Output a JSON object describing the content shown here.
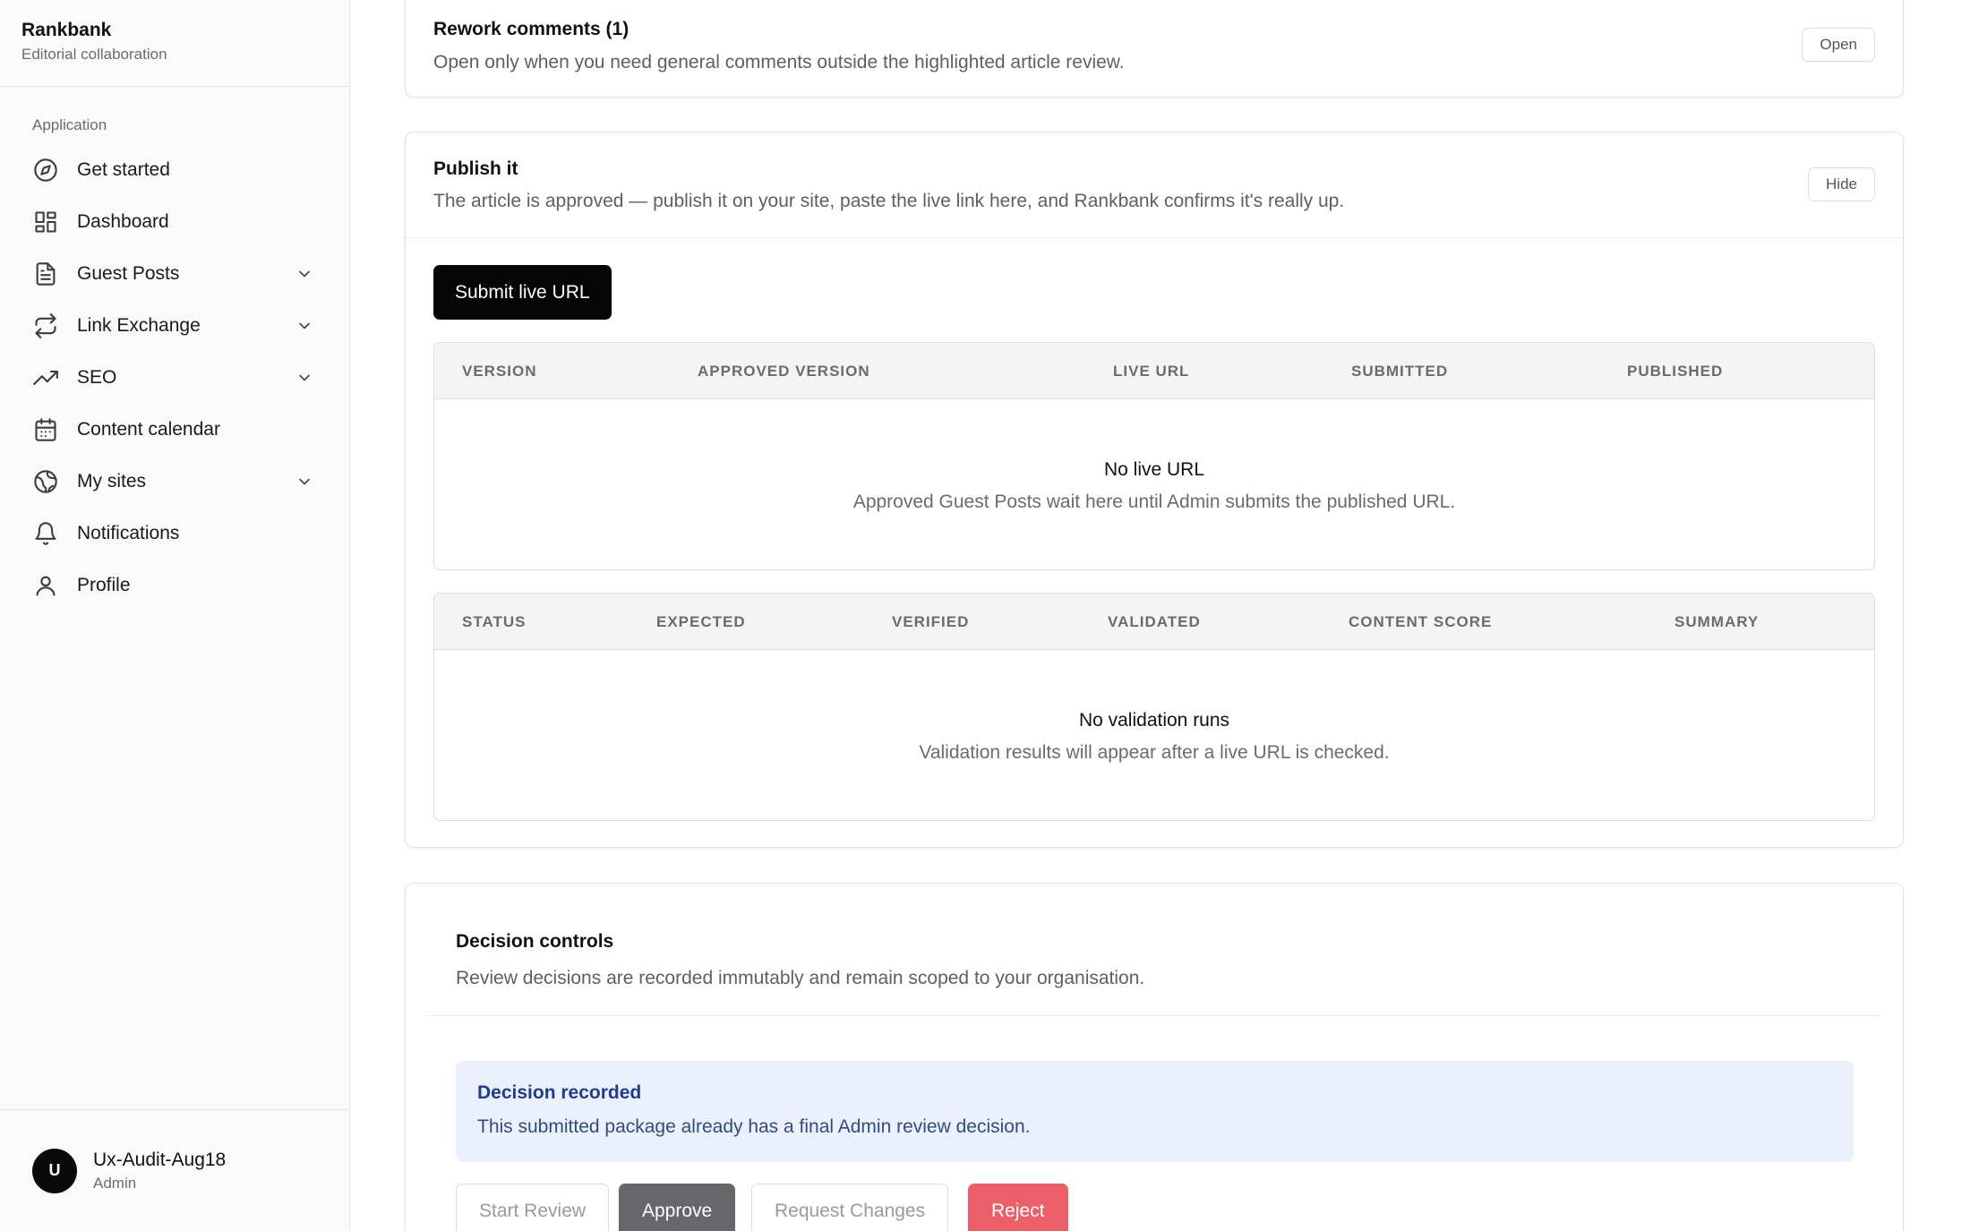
{
  "sidebar": {
    "brand": "Rankbank",
    "brand_sub": "Editorial collaboration",
    "group_label": "Application",
    "items": [
      {
        "label": "Get started",
        "icon": "compass-icon",
        "chevron": false
      },
      {
        "label": "Dashboard",
        "icon": "grid-icon",
        "chevron": false
      },
      {
        "label": "Guest Posts",
        "icon": "document-icon",
        "chevron": true
      },
      {
        "label": "Link Exchange",
        "icon": "repeat-icon",
        "chevron": true
      },
      {
        "label": "SEO",
        "icon": "trending-up-icon",
        "chevron": true
      },
      {
        "label": "Content calendar",
        "icon": "calendar-icon",
        "chevron": false
      },
      {
        "label": "My sites",
        "icon": "globe-icon",
        "chevron": true
      },
      {
        "label": "Notifications",
        "icon": "bell-icon",
        "chevron": false
      },
      {
        "label": "Profile",
        "icon": "user-icon",
        "chevron": false
      }
    ],
    "user": {
      "initial": "U",
      "name": "Ux-Audit-Aug18",
      "role": "Admin"
    }
  },
  "rework": {
    "title": "Rework comments (1)",
    "description": "Open only when you need general comments outside the highlighted article review.",
    "button": "Open"
  },
  "publish": {
    "title": "Publish it",
    "description": "The article is approved — publish it on your site, paste the live link here, and Rankbank confirms it's really up.",
    "hide_button": "Hide",
    "submit_button": "Submit live URL",
    "urls_table": {
      "columns": [
        "VERSION",
        "APPROVED VERSION",
        "LIVE URL",
        "SUBMITTED",
        "PUBLISHED"
      ],
      "empty_title": "No live URL",
      "empty_text": "Approved Guest Posts wait here until Admin submits the published URL."
    },
    "validation_table": {
      "columns": [
        "STATUS",
        "EXPECTED",
        "VERIFIED",
        "VALIDATED",
        "CONTENT SCORE",
        "SUMMARY"
      ],
      "empty_title": "No validation runs",
      "empty_text": "Validation results will appear after a live URL is checked."
    }
  },
  "decision": {
    "title": "Decision controls",
    "description": "Review decisions are recorded immutably and remain scoped to your organisation.",
    "notice_title": "Decision recorded",
    "notice_text": "This submitted package already has a final Admin review decision.",
    "buttons": {
      "start_review": "Start Review",
      "approve": "Approve",
      "request_changes": "Request Changes",
      "reject": "Reject"
    }
  },
  "colors": {
    "accent_notice": "#eaf1fd",
    "reject": "#ec5f68",
    "approve": "#67676b"
  }
}
